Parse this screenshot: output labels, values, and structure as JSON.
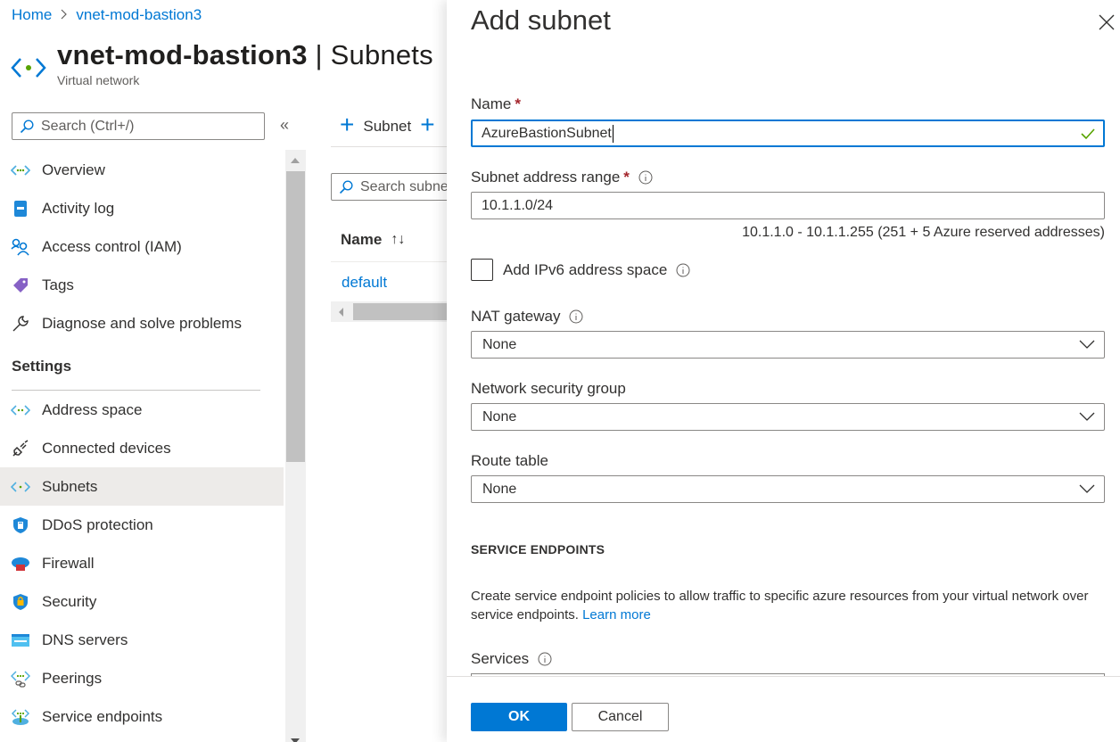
{
  "breadcrumb": {
    "home": "Home",
    "separator": ">",
    "current": "vnet-mod-bastion3"
  },
  "header": {
    "resource_name": "vnet-mod-bastion3",
    "pipe": "|",
    "blade_name": "Subnets",
    "subtitle": "Virtual network",
    "icon": "virtual-network-icon"
  },
  "sidebar": {
    "search_placeholder": "Search (Ctrl+/)",
    "collapse_label": "«",
    "items": [
      {
        "label": "Overview",
        "icon": "overview-icon"
      },
      {
        "label": "Activity log",
        "icon": "activity-log-icon"
      },
      {
        "label": "Access control (IAM)",
        "icon": "access-control-icon"
      },
      {
        "label": "Tags",
        "icon": "tag-icon"
      },
      {
        "label": "Diagnose and solve problems",
        "icon": "wrench-icon"
      }
    ],
    "section_settings": "Settings",
    "settings_items": [
      {
        "label": "Address space",
        "icon": "address-space-icon"
      },
      {
        "label": "Connected devices",
        "icon": "plug-icon"
      },
      {
        "label": "Subnets",
        "icon": "subnets-icon",
        "active": true
      },
      {
        "label": "DDoS protection",
        "icon": "ddos-shield-icon"
      },
      {
        "label": "Firewall",
        "icon": "firewall-icon"
      },
      {
        "label": "Security",
        "icon": "security-shield-icon"
      },
      {
        "label": "DNS servers",
        "icon": "dns-icon"
      },
      {
        "label": "Peerings",
        "icon": "peerings-icon"
      },
      {
        "label": "Service endpoints",
        "icon": "service-endpoints-icon"
      }
    ]
  },
  "toolbar": {
    "add_subnet_label": "Subnet",
    "plus_icon": "+"
  },
  "grid": {
    "search_placeholder": "Search subnets",
    "columns": [
      {
        "label": "Name",
        "sort_icon": "↑↓"
      }
    ],
    "rows": [
      {
        "name": "default"
      }
    ]
  },
  "panel": {
    "title": "Add subnet",
    "close_icon": "close-icon",
    "name": {
      "label": "Name",
      "required": "*",
      "value": "AzureBastionSubnet",
      "valid": true
    },
    "address_range": {
      "label": "Subnet address range",
      "required": "*",
      "value": "10.1.1.0/24",
      "hint": "10.1.1.0 - 10.1.1.255 (251 + 5 Azure reserved addresses)"
    },
    "ipv6": {
      "label": "Add IPv6 address space",
      "checked": false
    },
    "nat_gateway": {
      "label": "NAT gateway",
      "value": "None"
    },
    "nsg": {
      "label": "Network security group",
      "value": "None"
    },
    "route_table": {
      "label": "Route table",
      "value": "None"
    },
    "service_endpoints": {
      "heading": "SERVICE ENDPOINTS",
      "description": "Create service endpoint policies to allow traffic to specific azure resources from your virtual network over service endpoints.",
      "learn_more": "Learn more",
      "services_label": "Services"
    },
    "footer": {
      "ok_label": "OK",
      "cancel_label": "Cancel"
    }
  },
  "colors": {
    "accent": "#0078d4",
    "required": "#a4262c",
    "valid": "#57a300",
    "active_nav_bg": "#edebe9"
  }
}
